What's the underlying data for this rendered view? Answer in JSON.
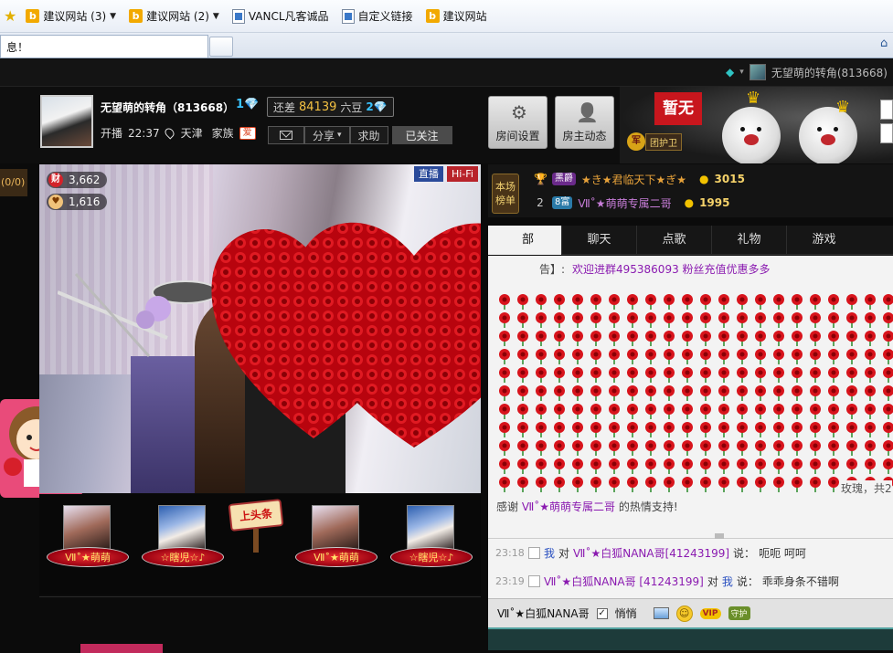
{
  "browser": {
    "favorites": [
      {
        "label": "建议网站 (3)",
        "icon": "b",
        "caret": true
      },
      {
        "label": "建议网站 (2)",
        "icon": "b",
        "caret": true
      },
      {
        "label": "VANCL凡客诚品",
        "icon": "page",
        "caret": false
      },
      {
        "label": "自定义链接",
        "icon": "page",
        "caret": false
      },
      {
        "label": "建议网站",
        "icon": "b",
        "caret": false
      }
    ],
    "tab_title": "息！"
  },
  "top_user": {
    "name": "无望萌的转角(813668)"
  },
  "host": {
    "name": "无望萌的转角（813668）",
    "level": "1",
    "gap_prefix": "还差",
    "gap_value": "84139",
    "gap_unit": "六豆",
    "next_level": "2",
    "live_label": "开播",
    "live_time": "22:37",
    "city": "天津",
    "family_label": "家族",
    "family_badge": "爱"
  },
  "actions": {
    "share": "分享",
    "help": "求助",
    "follow": "已关注"
  },
  "tools": {
    "room_settings": "房间设置",
    "host_feed": "房主动态"
  },
  "banner": {
    "flag": "暂无",
    "guard_badge": "军",
    "guard_label": "团护卫"
  },
  "left_tag": "(0/0)",
  "video": {
    "wealth_icon": "财",
    "wealth_value": "3,662",
    "fans_value": "1,616",
    "tag_live": "直播",
    "tag_hifi": "Hi-Fi"
  },
  "thumbs": [
    {
      "name": "Ⅶ˚★萌萌"
    },
    {
      "name": "☆瞎児☆♪"
    },
    {
      "name": "Ⅶ˚★萌萌"
    },
    {
      "name": "☆瞎児☆♪"
    }
  ],
  "headline_label": "上头条",
  "rank": {
    "label_line1": "本场",
    "label_line2": "榜单",
    "rows": [
      {
        "no": "",
        "badge": "黑爵",
        "name": "★き★君临天下★ぎ★",
        "score": "3015"
      },
      {
        "no": "2",
        "badge": "8富",
        "name": "Ⅶ˚★萌萌专属二哥",
        "score": "1995"
      }
    ]
  },
  "chat_tabs": [
    "部",
    "聊天",
    "点歌",
    "礼物",
    "游戏"
  ],
  "chat": {
    "notice_prefix": "告】:",
    "notice": "欢迎进群495386093 粉丝充值优惠多多",
    "rose_caption": "玫瑰，共2",
    "thanks_prefix": "感谢",
    "thanks_name": "Ⅶ˚★萌萌专属二哥",
    "thanks_suffix": "的热情支持!",
    "messages": [
      {
        "time": "23:18",
        "from": "我",
        "verb": "对",
        "to": "Ⅶ˚★白狐NANA哥[41243199]",
        "said": "说：",
        "text": "呃呃 呵呵"
      },
      {
        "time": "23:19",
        "from": "Ⅶ˚★白狐NANA哥 [41243199]",
        "verb": "对",
        "to": "我",
        "said": "说：",
        "text": "乖乖身条不错啊"
      }
    ]
  },
  "input": {
    "target": "Ⅶ˚★白狐NANA哥",
    "whisper": "悄悄",
    "vip": "VIP",
    "guard": "守护"
  }
}
